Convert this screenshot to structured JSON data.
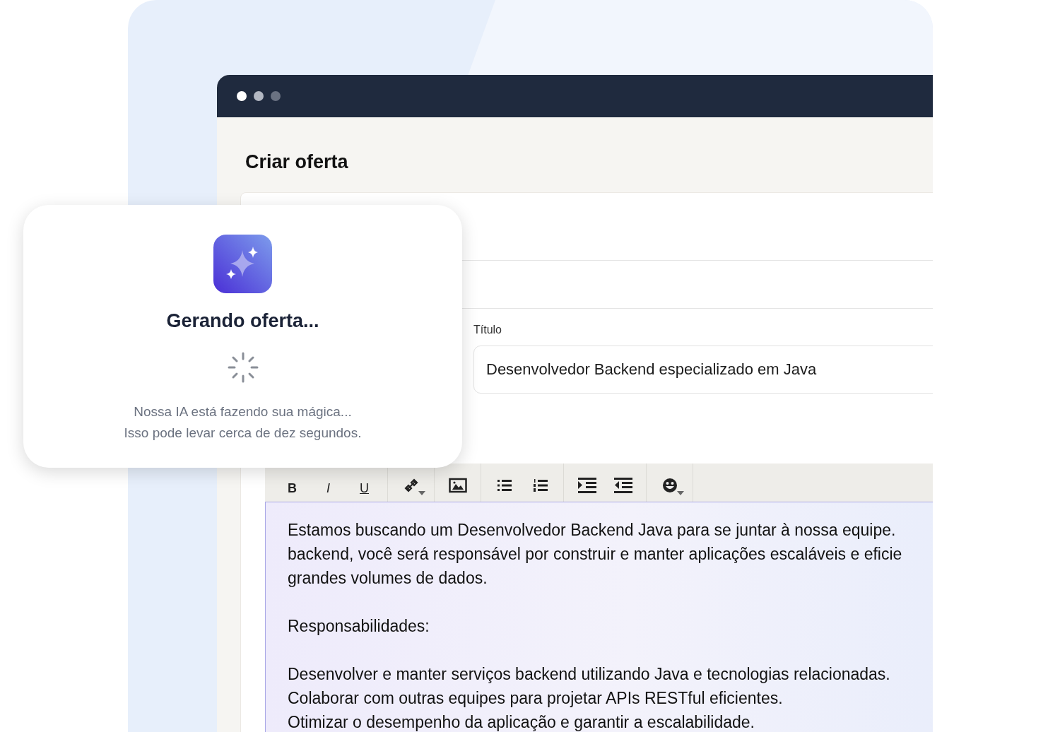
{
  "page": {
    "title": "Criar oferta"
  },
  "form": {
    "title_field": {
      "label": "Título",
      "value": "Desenvolvedor Backend especializado em Java"
    },
    "toolbar": [
      [
        {
          "kind": "bold",
          "label": "B"
        },
        {
          "kind": "italic",
          "label": "I"
        },
        {
          "kind": "underline",
          "label": "U"
        }
      ],
      [
        {
          "kind": "link",
          "dropdown": true
        }
      ],
      [
        {
          "kind": "image",
          "dropdown": false
        }
      ],
      [
        {
          "kind": "bullet-list",
          "dropdown": false
        },
        {
          "kind": "numbered-list",
          "dropdown": false
        }
      ],
      [
        {
          "kind": "indent",
          "dropdown": false
        },
        {
          "kind": "outdent",
          "dropdown": false
        }
      ],
      [
        {
          "kind": "emoji",
          "dropdown": true
        }
      ]
    ],
    "editor_paragraphs": [
      {
        "lines": [
          "Estamos buscando um Desenvolvedor Backend Java para se juntar à nossa equipe.",
          "backend, você será responsável por construir e manter aplicações escaláveis e eficie",
          "grandes volumes de dados."
        ]
      },
      {
        "lines": [
          "Responsabilidades:"
        ]
      },
      {
        "lines": [
          "Desenvolver e manter serviços backend utilizando Java e tecnologias relacionadas.",
          "Colaborar com outras equipes para projetar APIs RESTful eficientes.",
          "Otimizar o desempenho da aplicação e garantir a escalabilidade."
        ]
      }
    ]
  },
  "dialog": {
    "title": "Gerando oferta...",
    "message_lines": [
      "Nossa IA está fazendo sua mágica...",
      "Isso pode levar cerca de dez segundos."
    ]
  }
}
